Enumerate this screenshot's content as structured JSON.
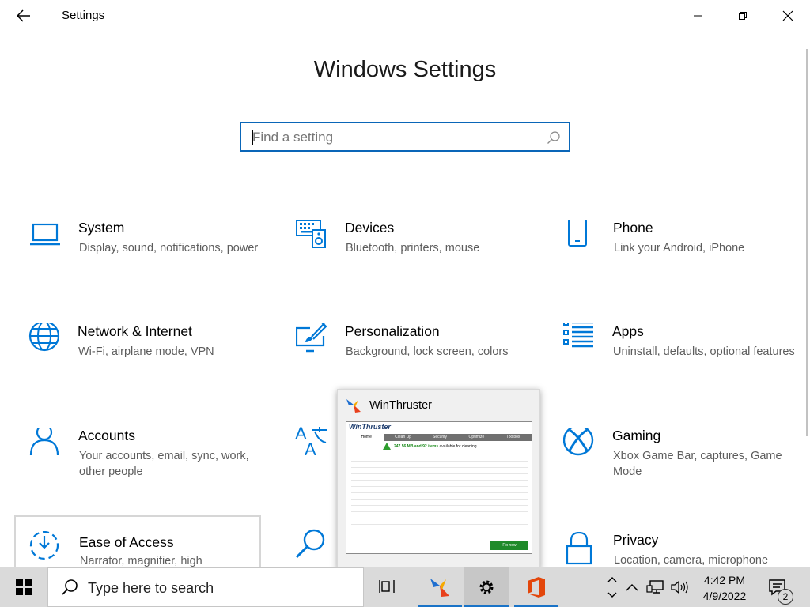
{
  "window": {
    "app_title": "Settings",
    "page_title": "Windows Settings"
  },
  "search": {
    "placeholder": "Find a setting"
  },
  "tiles": [
    {
      "name": "System",
      "desc": "Display, sound, notifications, power",
      "icon": "laptop-icon"
    },
    {
      "name": "Devices",
      "desc": "Bluetooth, printers, mouse",
      "icon": "devices-icon"
    },
    {
      "name": "Phone",
      "desc": "Link your Android, iPhone",
      "icon": "phone-icon"
    },
    {
      "name": "Network & Internet",
      "desc": "Wi-Fi, airplane mode, VPN",
      "icon": "globe-icon"
    },
    {
      "name": "Personalization",
      "desc": "Background, lock screen, colors",
      "icon": "paintbrush-icon"
    },
    {
      "name": "Apps",
      "desc": "Uninstall, defaults, optional features",
      "icon": "apps-list-icon"
    },
    {
      "name": "Accounts",
      "desc": "Your accounts, email, sync, work, other people",
      "icon": "person-icon"
    },
    {
      "name": "Gaming",
      "desc": "Xbox Game Bar, captures, Game Mode",
      "icon": "xbox-icon"
    },
    {
      "name": "Ease of Access",
      "desc": "Narrator, magnifier, high",
      "icon": "ease-of-access-icon"
    },
    {
      "name": "Privacy",
      "desc": "Location, camera, microphone",
      "icon": "lock-icon"
    }
  ],
  "taskbar": {
    "search_text": "Type here to search",
    "preview_title": "WinThruster",
    "clock_time": "4:42 PM",
    "clock_date": "4/9/2022",
    "notification_count": "2"
  },
  "preview_app": {
    "logo": "WinThruster",
    "tabs": [
      "Home",
      "Clean Up",
      "Security",
      "Optimize",
      "Toolbox"
    ],
    "summary_amount": "247.56 MB and 92 items",
    "summary_suffix": "available for cleaning",
    "fix_button": "Fix now"
  },
  "colors": {
    "accent": "#0a66b8",
    "icon_blue": "#0078d7",
    "taskbar_bg": "#dadada",
    "desc_gray": "#5d5d5d"
  }
}
